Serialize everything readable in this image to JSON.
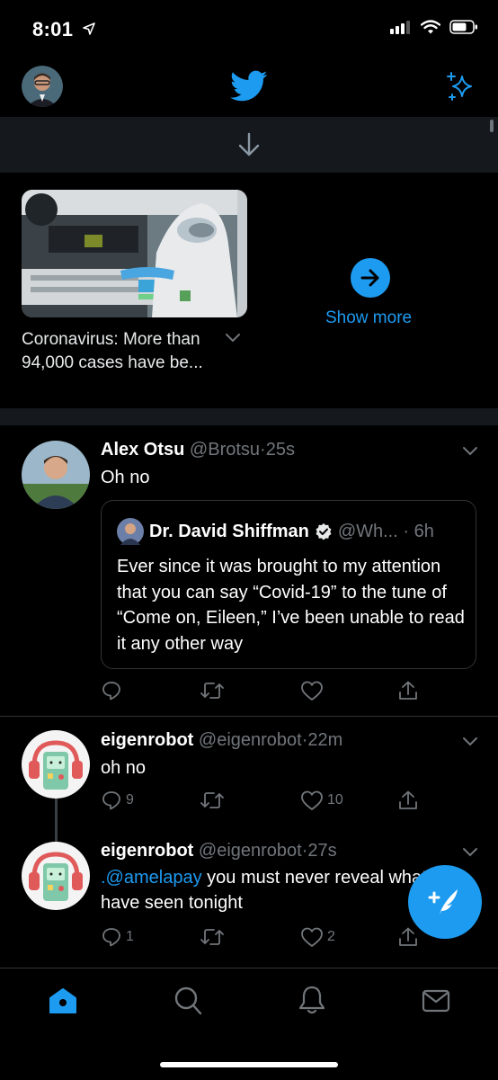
{
  "status_bar": {
    "time": "8:01"
  },
  "trending": {
    "headline": "Coronavirus: More than 94,000 cases have be...",
    "show_more_label": "Show more"
  },
  "tweets": [
    {
      "name": "Alex Otsu",
      "handle": "@Brotsu",
      "sep": "·",
      "time": "25s",
      "text": "Oh no",
      "quote": {
        "name": "Dr. David Shiffman",
        "handle": "@Wh...",
        "sep": "·",
        "time": "6h",
        "text": "Ever since it was brought to my attention that you can say “Covid-19” to the tune of “Come on, Eileen,” I’ve been unable to read it any other way"
      }
    },
    {
      "name": "eigenrobot",
      "handle": "@eigenrobot",
      "sep": "·",
      "time": "22m",
      "text": "oh no",
      "replies": "9",
      "likes": "10"
    },
    {
      "name": "eigenrobot",
      "handle": "@eigenrobot",
      "sep": "·",
      "time": "27s",
      "mention": ".@amelapay",
      "text": " you must never reveal what you have seen tonight",
      "replies": "1",
      "likes": "2"
    }
  ],
  "colors": {
    "accent": "#1d9bf0",
    "background": "#000000",
    "muted": "#71767b"
  },
  "icons": [
    "location-arrow-icon",
    "signal-icon",
    "wifi-icon",
    "battery-icon",
    "twitter-bird-icon",
    "sparkle-icon",
    "arrow-down-icon",
    "arrow-right-icon",
    "chevron-down-icon",
    "verified-badge-icon",
    "reply-icon",
    "retweet-icon",
    "like-icon",
    "share-icon",
    "compose-icon",
    "home-icon",
    "search-icon",
    "notifications-icon",
    "messages-icon"
  ]
}
